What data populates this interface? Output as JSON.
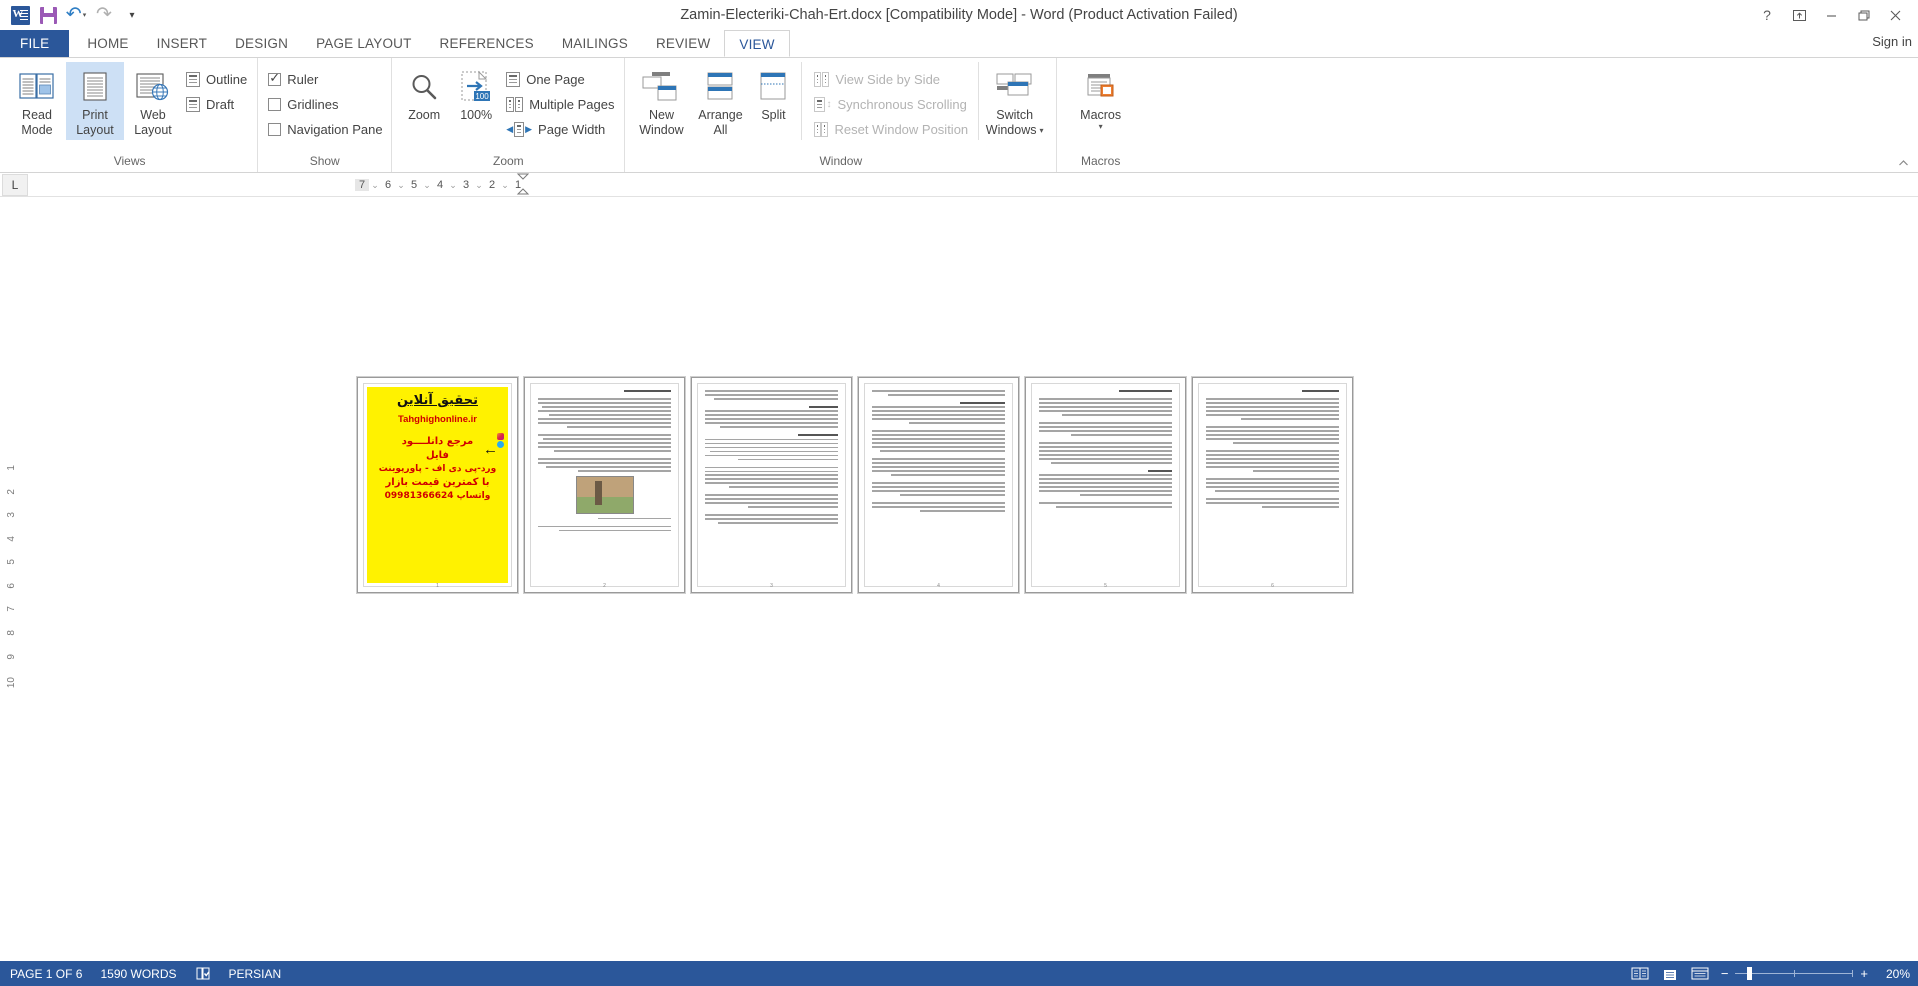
{
  "window": {
    "title": "Zamin-Electeriki-Chah-Ert.docx [Compatibility Mode] - Word (Product Activation Failed)",
    "help_icon": "help-icon",
    "ribbon_display_icon": "ribbon-display-options-icon",
    "minimize_icon": "minimize-icon",
    "restore_icon": "restore-icon",
    "close_icon": "close-icon",
    "signin": "Sign in"
  },
  "quick_access": {
    "app_icon": "word-logo-icon",
    "save": "save-icon",
    "undo": "undo-icon",
    "redo": "redo-icon",
    "customize": "customize-quick-access-toolbar-icon"
  },
  "tabs": [
    {
      "label": "FILE",
      "active": false,
      "kind": "file"
    },
    {
      "label": "HOME",
      "active": false
    },
    {
      "label": "INSERT",
      "active": false
    },
    {
      "label": "DESIGN",
      "active": false
    },
    {
      "label": "PAGE LAYOUT",
      "active": false
    },
    {
      "label": "REFERENCES",
      "active": false
    },
    {
      "label": "MAILINGS",
      "active": false
    },
    {
      "label": "REVIEW",
      "active": false
    },
    {
      "label": "VIEW",
      "active": true
    }
  ],
  "ribbon": {
    "views": {
      "label": "Views",
      "buttons": [
        {
          "line1": "Read",
          "line2": "Mode",
          "icon": "read-mode-icon",
          "selected": false
        },
        {
          "line1": "Print",
          "line2": "Layout",
          "icon": "print-layout-icon",
          "selected": true
        },
        {
          "line1": "Web",
          "line2": "Layout",
          "icon": "web-layout-icon",
          "selected": false
        }
      ],
      "small": [
        {
          "label": "Outline",
          "icon": "outline-view-icon"
        },
        {
          "label": "Draft",
          "icon": "draft-view-icon"
        }
      ]
    },
    "show": {
      "label": "Show",
      "checkboxes": [
        {
          "label": "Ruler",
          "checked": true
        },
        {
          "label": "Gridlines",
          "checked": false
        },
        {
          "label": "Navigation Pane",
          "checked": false
        }
      ]
    },
    "zoom": {
      "label": "Zoom",
      "buttons": [
        {
          "line1": "Zoom",
          "line2": "",
          "icon": "magnifier-icon"
        },
        {
          "line1": "100%",
          "line2": "",
          "icon": "zoom-100-icon"
        }
      ],
      "small": [
        {
          "label": "One Page",
          "icon": "one-page-icon"
        },
        {
          "label": "Multiple Pages",
          "icon": "multiple-pages-icon"
        },
        {
          "label": "Page Width",
          "icon": "page-width-icon"
        }
      ]
    },
    "window": {
      "label": "Window",
      "buttons": [
        {
          "line1": "New",
          "line2": "Window",
          "icon": "new-window-icon"
        },
        {
          "line1": "Arrange",
          "line2": "All",
          "icon": "arrange-all-icon"
        },
        {
          "line1": "Split",
          "line2": "",
          "icon": "split-icon"
        }
      ],
      "small": [
        {
          "label": "View Side by Side",
          "icon": "view-side-by-side-icon",
          "disabled": true
        },
        {
          "label": "Synchronous Scrolling",
          "icon": "synchronous-scrolling-icon",
          "disabled": true
        },
        {
          "label": "Reset Window Position",
          "icon": "reset-window-position-icon",
          "disabled": true
        }
      ],
      "switch": {
        "line1": "Switch",
        "line2": "Windows",
        "icon": "switch-windows-icon",
        "has_caret": true
      }
    },
    "macros": {
      "label": "Macros",
      "button": {
        "line1": "Macros",
        "line2": "",
        "icon": "macros-icon",
        "has_caret": true
      }
    }
  },
  "ruler": {
    "tab_stop_selector": "L",
    "numbers": [
      "7",
      "6",
      "5",
      "4",
      "3",
      "2",
      "1"
    ],
    "indent_marker": "first-line-indent-marker"
  },
  "vertical_ruler": [
    "1",
    "2",
    "3",
    "4",
    "5",
    "6",
    "7",
    "8",
    "9",
    "10"
  ],
  "document": {
    "page_count": 6,
    "pages": [
      {
        "number": "1",
        "type": "cover",
        "cover": {
          "title": "تحقیق آنلاین",
          "site": "Tahghighonline.ir",
          "line1": "مرجع دانلــــود",
          "line2": "فایل",
          "line3": "ورد-پی دی اف - پاورپوینت",
          "line4": "با کمترین قیمت بازار",
          "line5": "واتساپ 09981366624",
          "instagram_icon": "instagram-icon",
          "telegram_icon": "telegram-icon",
          "arrow_icon": "left-arrow-icon",
          "background_color": "#fff200",
          "text_color": "#d00000"
        }
      },
      {
        "number": "2",
        "type": "text",
        "heading": "تعریف الکتریکی",
        "has_image": true
      },
      {
        "number": "3",
        "type": "text",
        "heading": "",
        "has_image": false
      },
      {
        "number": "4",
        "type": "text",
        "heading": "",
        "has_image": false
      },
      {
        "number": "5",
        "type": "text",
        "heading": "اتصال ارت الکتریکی",
        "has_image": false
      },
      {
        "number": "6",
        "type": "text",
        "heading": "",
        "has_image": false
      }
    ]
  },
  "status_bar": {
    "page": "PAGE 1 OF 6",
    "words": "1590 WORDS",
    "proofing_icon": "proofing-errors-icon",
    "language": "PERSIAN",
    "view_read_mode": "read-mode-view-icon",
    "view_print_layout": "print-layout-view-icon",
    "view_web_layout": "web-layout-view-icon",
    "zoom_out": "−",
    "zoom_in": "+",
    "zoom_level": "20%",
    "accent_color": "#2b579a"
  }
}
